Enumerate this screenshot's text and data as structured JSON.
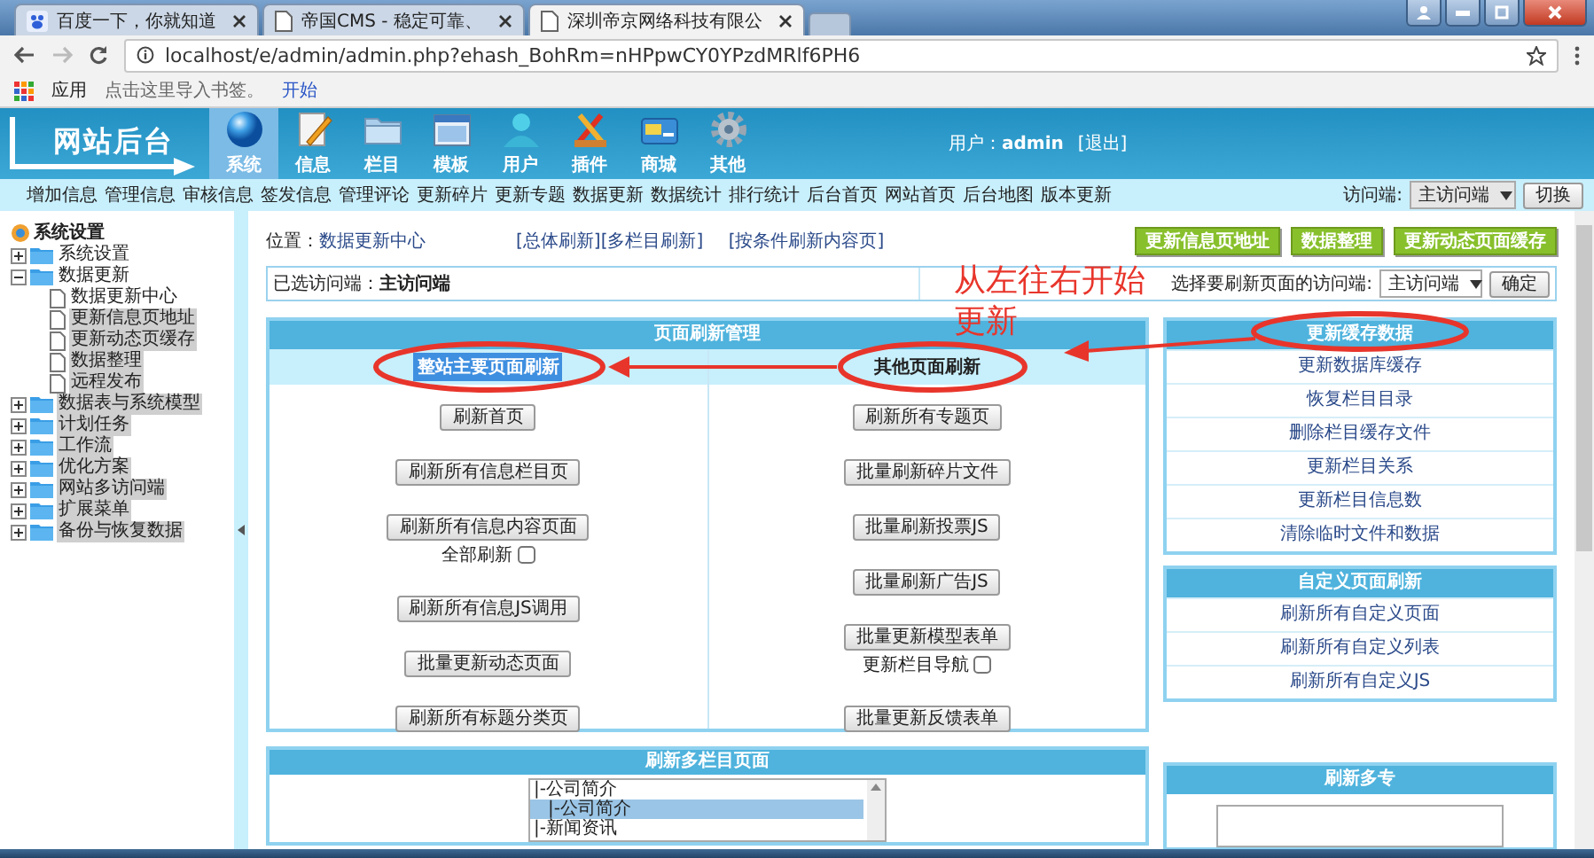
{
  "browser": {
    "tabs": [
      {
        "title": "百度一下，你就知道",
        "selected": false
      },
      {
        "title": "帝国CMS - 稳定可靠、",
        "selected": false
      },
      {
        "title": "深圳帝京网络科技有限公",
        "selected": true
      }
    ],
    "url": "localhost/e/admin/admin.php?ehash_BohRm=nHPpwCY0YPzdMRlf6PH6",
    "bookmarks": [
      {
        "kind": "apps",
        "label": "应用"
      },
      {
        "kind": "hint",
        "label": "点击这里导入书签。"
      },
      {
        "kind": "link",
        "label": "开始"
      }
    ]
  },
  "header": {
    "logo": "网站后台",
    "modules": [
      {
        "label": "系统",
        "selected": true
      },
      {
        "label": "信息",
        "selected": false
      },
      {
        "label": "栏目",
        "selected": false
      },
      {
        "label": "模板",
        "selected": false
      },
      {
        "label": "用户",
        "selected": false
      },
      {
        "label": "插件",
        "selected": false
      },
      {
        "label": "商城",
        "selected": false
      },
      {
        "label": "其他",
        "selected": false
      }
    ],
    "user": "用户：**admin**",
    "logout": "[退出]"
  },
  "menu": {
    "items": [
      "增加信息",
      "管理信息",
      "审核信息",
      "签发信息",
      "管理评论",
      "更新碎片",
      "更新专题",
      "数据更新",
      "数据统计",
      "排行统计",
      "后台首页",
      "网站首页",
      "后台地图",
      "版本更新"
    ],
    "visitor_label": "访问端:",
    "visitor_select": "主访问端",
    "switch_button": "切换"
  },
  "sidebar": {
    "title": "系统设置",
    "tree": [
      {
        "label": "系统设置",
        "expanded": false,
        "highlighted": false
      },
      {
        "label": "数据更新",
        "expanded": true,
        "highlighted": false,
        "children": [
          {
            "label": "数据更新中心",
            "highlighted": false
          },
          {
            "label": "更新信息页地址",
            "highlighted": true
          },
          {
            "label": "更新动态页缓存",
            "highlighted": true
          },
          {
            "label": "数据整理",
            "highlighted": true
          },
          {
            "label": "远程发布",
            "highlighted": true
          }
        ]
      },
      {
        "label": "数据表与系统模型",
        "expanded": false,
        "highlighted": true
      },
      {
        "label": "计划任务",
        "expanded": false,
        "highlighted": true
      },
      {
        "label": "工作流",
        "expanded": false,
        "highlighted": true
      },
      {
        "label": "优化方案",
        "expanded": false,
        "highlighted": true
      },
      {
        "label": "网站多访问端",
        "expanded": false,
        "highlighted": true
      },
      {
        "label": "扩展菜单",
        "expanded": false,
        "highlighted": true
      },
      {
        "label": "备份与恢复数据",
        "expanded": false,
        "highlighted": true
      }
    ]
  },
  "main": {
    "location_label": "位置：",
    "location": "数据更新中心",
    "links": [
      "[总体刷新]",
      "[多栏目刷新]",
      "[按条件刷新内容页]"
    ],
    "green_buttons": [
      "更新信息页地址",
      "数据整理",
      "更新动态页面缓存"
    ],
    "selected_visitor": "已选访问端：**主访问端**",
    "visitor_prompt": "选择要刷新页面的访问端:",
    "visitor_select": "主访问端",
    "confirm_button": "确定",
    "refresh_panel": {
      "title": "页面刷新管理",
      "columns": [
        {
          "heading": "整站主要页面刷新",
          "highlighted": true,
          "items": [
            {
              "label": "刷新首页"
            },
            {
              "label": "刷新所有信息栏目页"
            },
            {
              "label": "刷新所有信息内容页面",
              "option": {
                "label": "全部刷新",
                "checked": false
              }
            },
            {
              "label": "刷新所有信息JS调用"
            },
            {
              "label": "批量更新动态页面"
            },
            {
              "label": "刷新所有标题分类页"
            }
          ]
        },
        {
          "heading": "其他页面刷新",
          "highlighted": false,
          "items": [
            {
              "label": "刷新所有专题页"
            },
            {
              "label": "批量刷新碎片文件"
            },
            {
              "label": "批量刷新投票JS"
            },
            {
              "label": "批量刷新广告JS"
            },
            {
              "label": "批量更新模型表单",
              "option": {
                "label": "更新栏目导航",
                "checked": false
              }
            },
            {
              "label": "批量更新反馈表单"
            }
          ]
        }
      ]
    },
    "cache_panel": {
      "title": "更新缓存数据",
      "links": [
        "更新数据库缓存",
        "恢复栏目目录",
        "删除栏目缓存文件",
        "更新栏目关系",
        "更新栏目信息数",
        "清除临时文件和数据"
      ]
    },
    "custom_panel": {
      "title": "自定义页面刷新",
      "links": [
        "刷新所有自定义页面",
        "刷新所有自定义列表",
        "刷新所有自定义JS"
      ]
    },
    "multi_column_panel": {
      "title": "刷新多栏目页面",
      "options": [
        {
          "label": "|-公司简介",
          "selected": false,
          "children": [
            {
              "label": "|-公司简介",
              "selected": true
            }
          ]
        },
        {
          "label": "|-新闻资讯",
          "selected": false
        }
      ]
    },
    "multi_topic_panel": {
      "title": "刷新多专"
    },
    "annotation": {
      "text": "从左往右开始更新"
    }
  }
}
